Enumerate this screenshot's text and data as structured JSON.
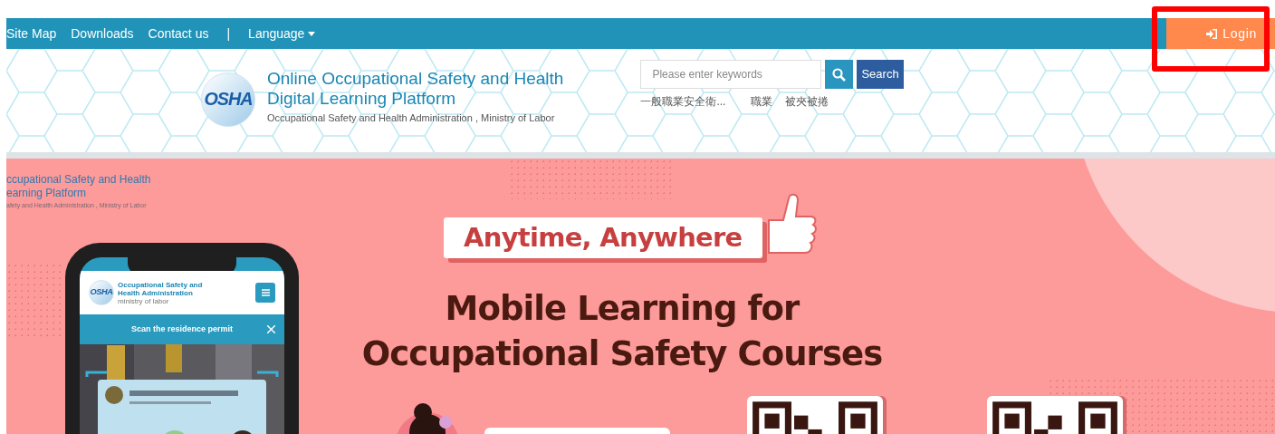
{
  "top_nav": {
    "links": [
      "Site Map",
      "Downloads",
      "Contact us"
    ],
    "separator": "|",
    "language": "Language",
    "login": "Login"
  },
  "header": {
    "logo": "OSHA",
    "title_lines": [
      "Online Occupational Safety and Health",
      "Digital Learning Platform"
    ],
    "subtitle": "Occupational Safety and Health Administration , Ministry of Labor",
    "search": {
      "placeholder": "Please enter keywords",
      "button": "Search"
    },
    "hot_keywords": [
      "一般職業安全衛...",
      "職業",
      "被夾被捲"
    ]
  },
  "banner": {
    "brand_lines": [
      "ccupational Safety and Health",
      "earning Platform"
    ],
    "brand_subtitle": "afety and Health Administration , Ministry of Labor",
    "tagline": "Anytime, Anywhere",
    "headline_lines": [
      "Mobile Learning for",
      "Occupational Safety Courses"
    ],
    "phone": {
      "logo": "OSHA",
      "org_name_lines": [
        "Occupational Safety and",
        "Health Administration"
      ],
      "org_sub": "ministry of labor",
      "scan_title": "Scan the residence permit"
    },
    "qr_codes": [
      {
        "kind": "qr"
      },
      {
        "kind": "qr"
      }
    ]
  }
}
